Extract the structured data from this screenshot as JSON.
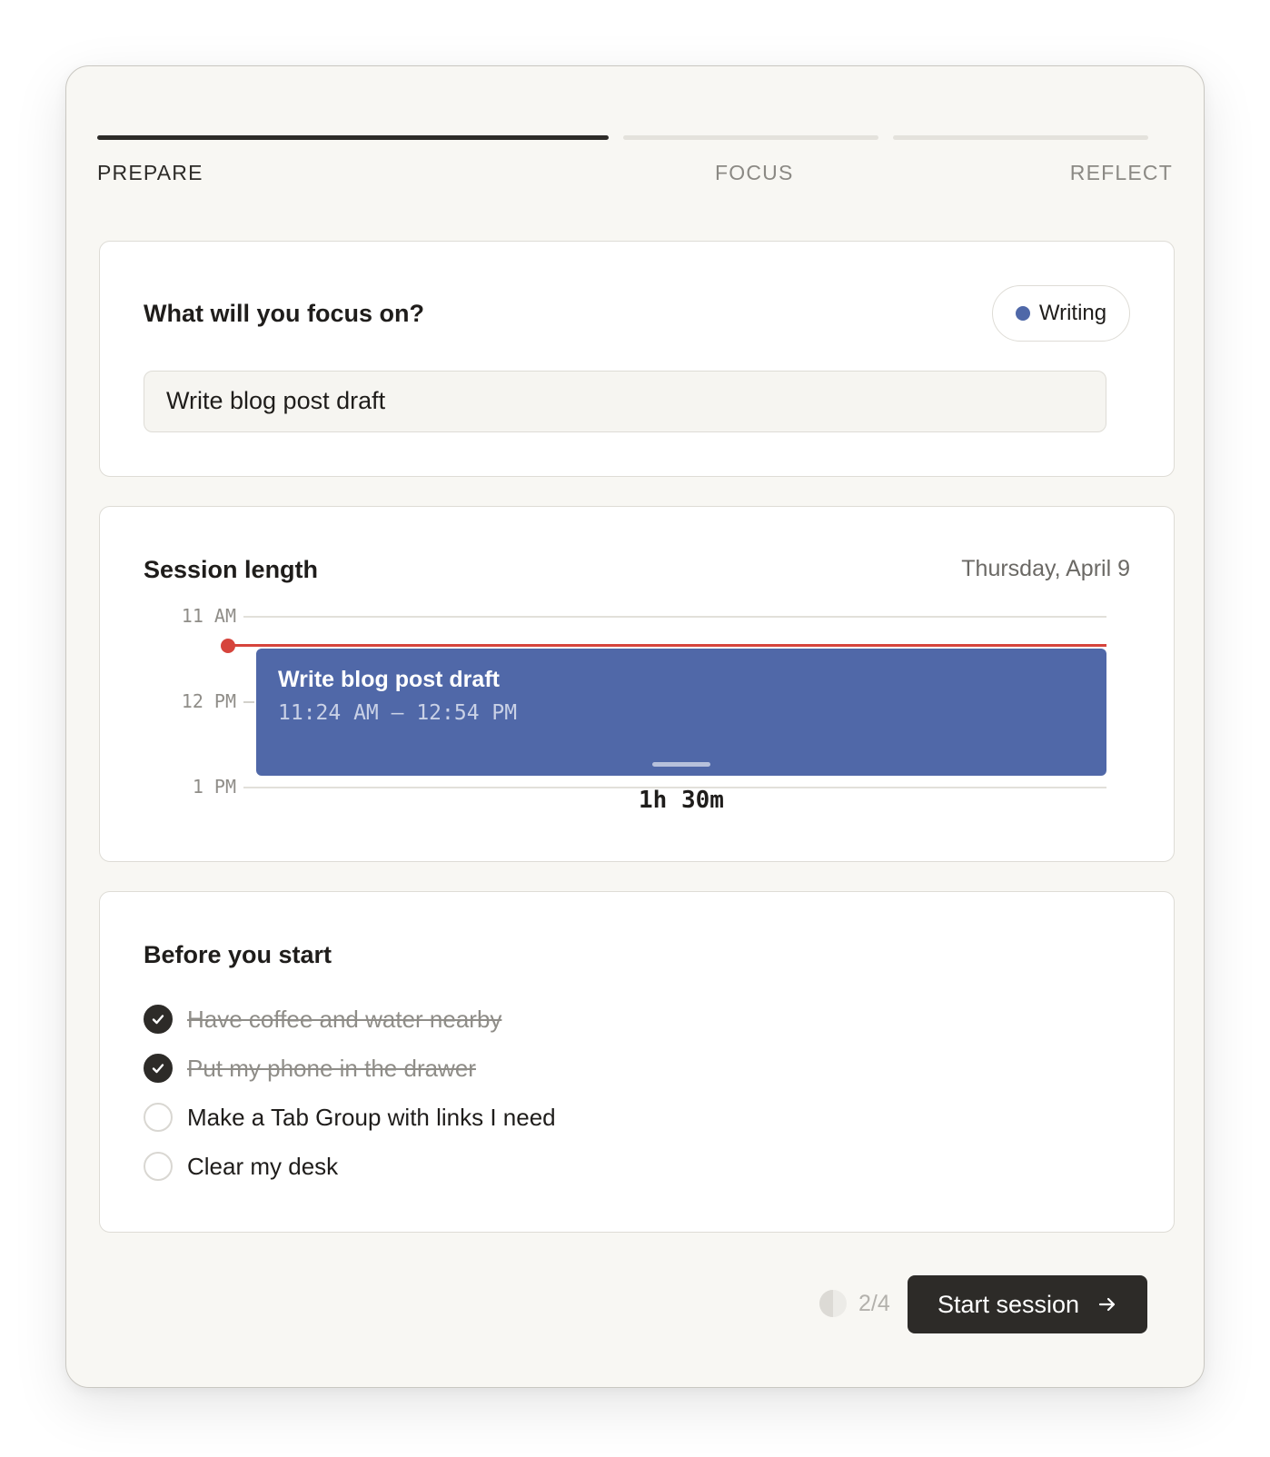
{
  "stepper": {
    "steps": [
      {
        "label": "PREPARE",
        "state": "active"
      },
      {
        "label": "FOCUS",
        "state": "upcoming"
      },
      {
        "label": "REFLECT",
        "state": "upcoming"
      }
    ]
  },
  "focus": {
    "title": "What will you focus on?",
    "category": {
      "label": "Writing",
      "color": "#4f68a8"
    },
    "input_value": "Write blog post draft"
  },
  "session": {
    "title": "Session length",
    "date": "Thursday, April 9",
    "hour_labels": [
      "11 AM",
      "12 PM",
      "1 PM"
    ],
    "event": {
      "title": "Write blog post draft",
      "time_range": "11:24 AM – 12:54 PM",
      "color": "#5068a8"
    },
    "duration": "1h 30m",
    "now_color": "#d6443c"
  },
  "checklist": {
    "title": "Before you start",
    "items": [
      {
        "label": "Have coffee and water nearby",
        "done": true
      },
      {
        "label": "Put my phone in the drawer",
        "done": true
      },
      {
        "label": "Make a Tab Group with links I need",
        "done": false
      },
      {
        "label": "Clear my desk",
        "done": false
      }
    ]
  },
  "footer": {
    "progress": "2/4",
    "progress_fraction": 0.5,
    "start_label": "Start session",
    "start_icon": "arrow-right-icon"
  }
}
